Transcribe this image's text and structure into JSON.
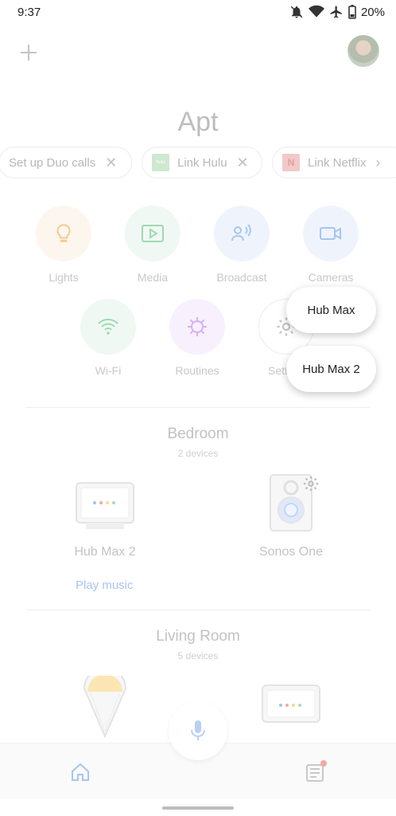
{
  "status_bar": {
    "time": "9:37",
    "battery": "20%"
  },
  "home": {
    "title": "Apt",
    "chips": [
      {
        "label": "Set up Duo calls"
      },
      {
        "label": "Link Hulu",
        "logo_text": "hulu"
      },
      {
        "label": "Link Netflix",
        "logo_text": "N"
      }
    ],
    "categories": [
      {
        "label": "Lights",
        "color": "#f5b96b"
      },
      {
        "label": "Media",
        "color": "#6fcf97"
      },
      {
        "label": "Broadcast",
        "color": "#72a8f2"
      },
      {
        "label": "Cameras",
        "color": "#72a8f2"
      },
      {
        "label": "Wi-Fi",
        "color": "#6fcf97"
      },
      {
        "label": "Routines",
        "color": "#c98ff0"
      },
      {
        "label": "Sett"
      }
    ],
    "rooms": [
      {
        "name": "Bedroom",
        "count": "2 devices",
        "devices": [
          {
            "name": "Hub Max 2",
            "action": "Play music"
          },
          {
            "name": "Sonos One"
          }
        ]
      },
      {
        "name": "Living Room",
        "count": "5 devices"
      }
    ]
  },
  "fab_menu": {
    "items": [
      "Hub Max",
      "Hub Max 2"
    ]
  }
}
